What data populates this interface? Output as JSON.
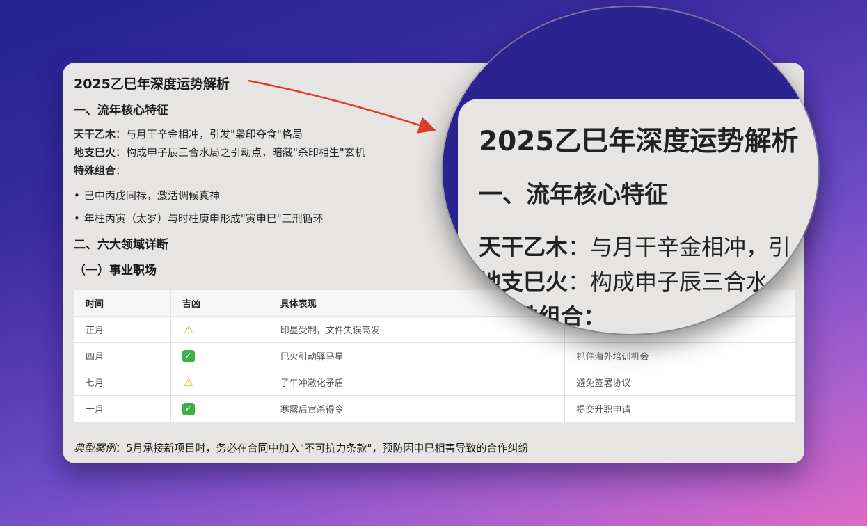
{
  "doc": {
    "title": "2025乙巳年深度运势解析",
    "section1": "一、流年核心特征",
    "line1_label": "天干乙木",
    "line1_text": "：与月干辛金相冲，引发\"枭印夺食\"格局",
    "line2_label": "地支巳火",
    "line2_text": "：构成申子辰三合水局之引动点，暗藏\"杀印相生\"玄机",
    "line3_label": "特殊组合",
    "line3_text": "：",
    "bullets": [
      "巳中丙戊同禄，激活调候真神",
      "年柱丙寅（太岁）与时柱庚申形成\"寅申巳\"三刑循环"
    ],
    "section2": "二、六大领域详断",
    "subsection": "（一）事业职场"
  },
  "table": {
    "headers": [
      "时间",
      "吉凶",
      "具体表现",
      ""
    ],
    "rows": [
      {
        "time": "正月",
        "icon": "warning-icon",
        "desc": "印星受制，文件失误高发",
        "advice": ""
      },
      {
        "time": "四月",
        "icon": "check-icon",
        "desc": "巳火引动驿马星",
        "advice": "抓住海外培训机会"
      },
      {
        "time": "七月",
        "icon": "warning-icon",
        "desc": "子午冲激化矛盾",
        "advice": "避免签署协议"
      },
      {
        "time": "十月",
        "icon": "check-icon",
        "desc": "寒露后官杀得令",
        "advice": "提交升职申请"
      }
    ]
  },
  "case": {
    "label": "典型案例",
    "text": "：5月承接新项目时，务必在合同中加入\"不可抗力条款\"，预防因申巳相害导致的合作纠纷"
  },
  "magnifier": {
    "title": "2025乙巳年深度运势解析",
    "section1": "一、流年核心特征",
    "line1_label": "天干乙木",
    "line1_text": "：与月干辛金相冲，引",
    "line2_label": "地支巳火",
    "line2_text": "：构成申子辰三合水",
    "line3_text": "殊组合："
  },
  "colors": {
    "arrow": "#e23a2a",
    "card": "#e7e5e3",
    "warning": "#e5b800",
    "check": "#3cb043"
  }
}
